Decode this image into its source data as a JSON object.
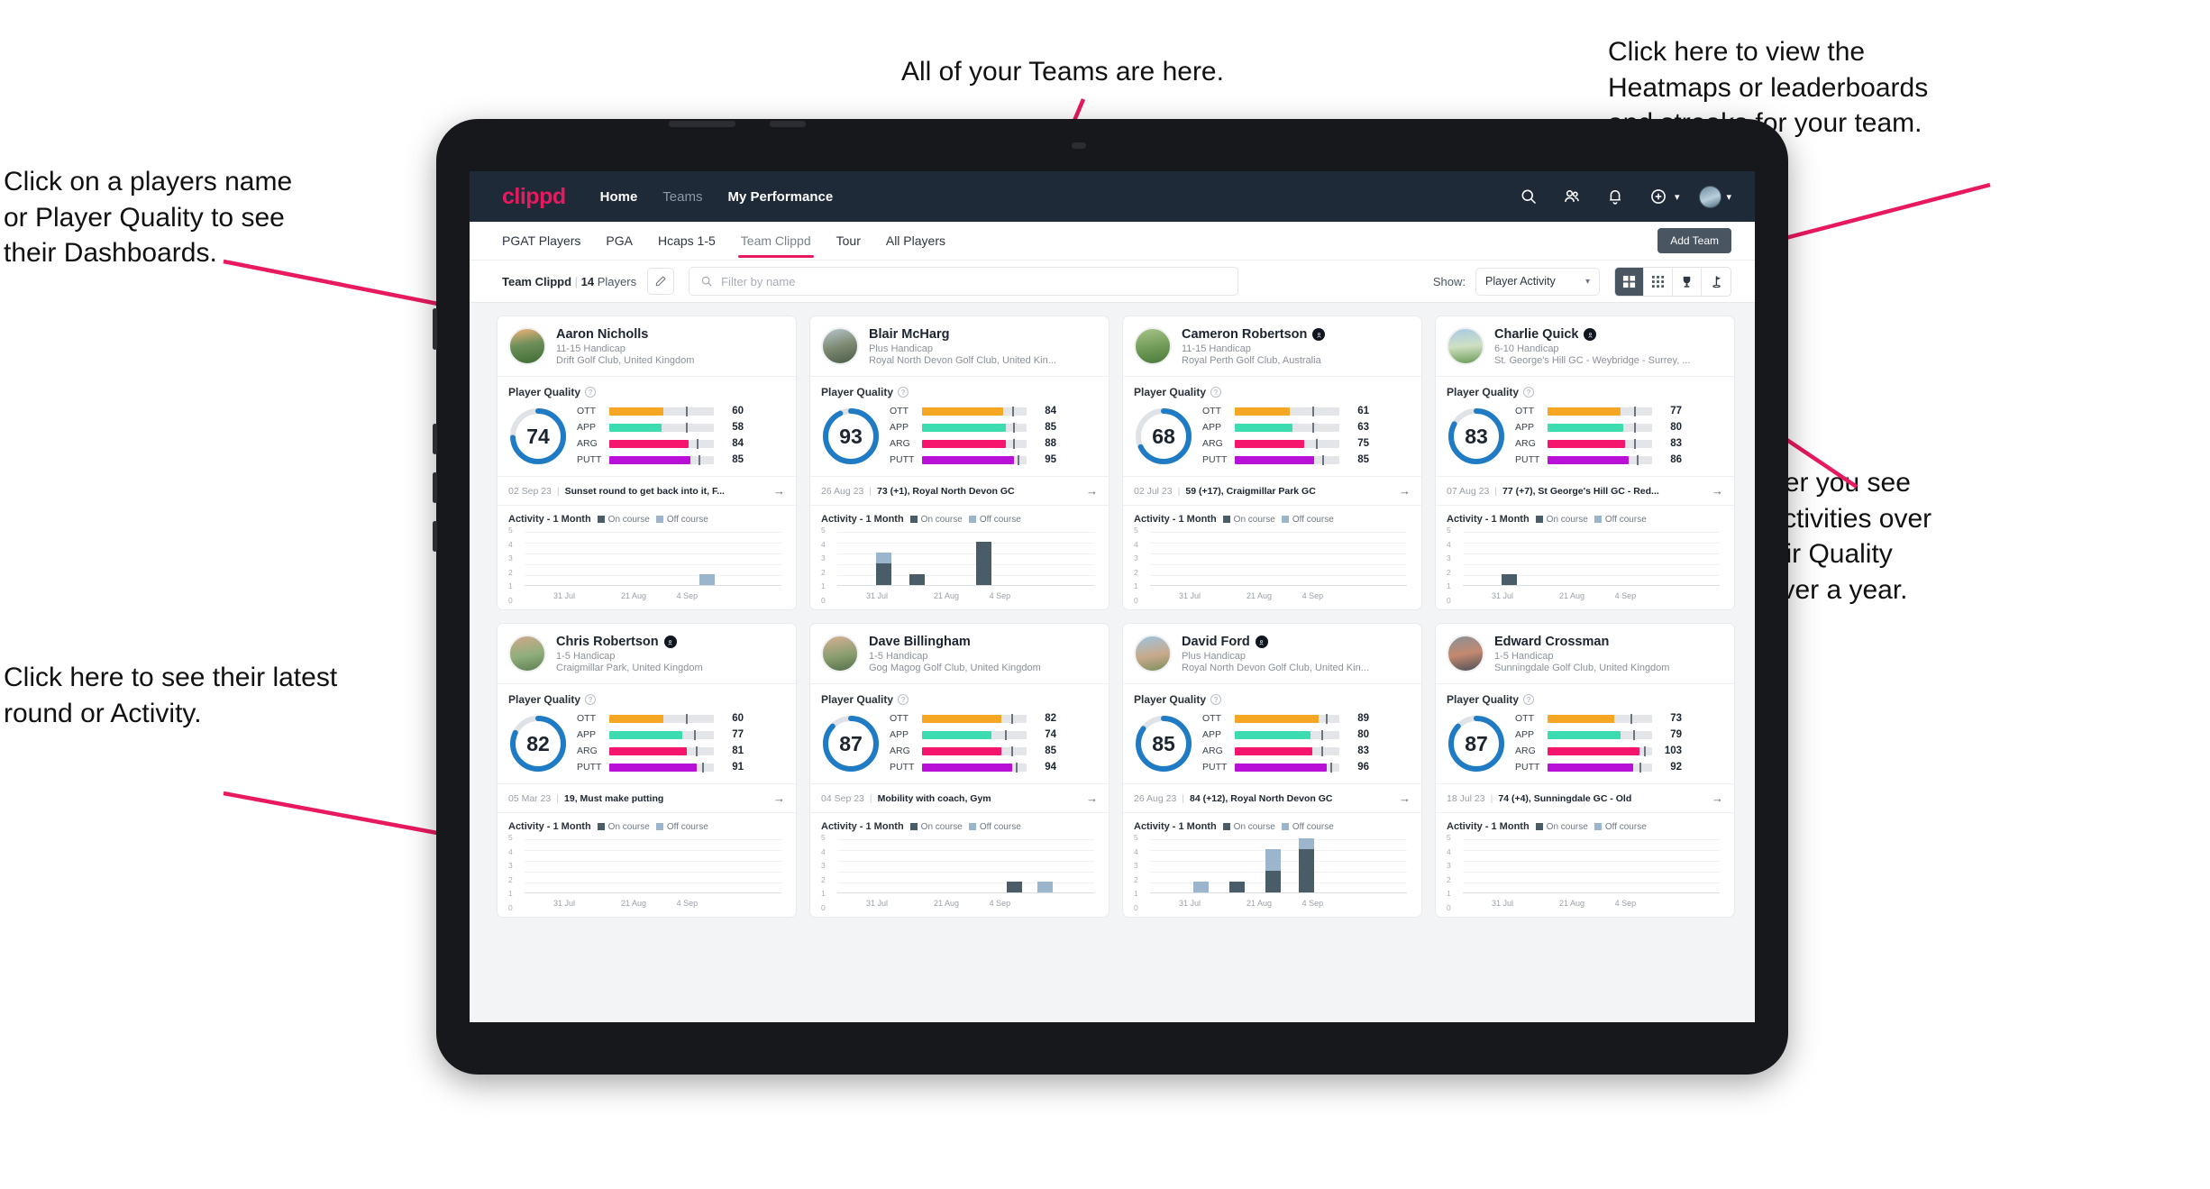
{
  "annotations": [
    {
      "id": "teams-note",
      "text": "All of your Teams are here."
    },
    {
      "id": "heatmaps-note",
      "text": "Click here to view the\nHeatmaps or leaderboards\nand streaks for your team."
    },
    {
      "id": "dashboards-note",
      "text": "Click on a players name\nor Player Quality to see\ntheir Dashboards."
    },
    {
      "id": "activity-toggle-note",
      "text": "Choose whether you see\nyour players Activities over\na month or their Quality\nScore Trend over a year."
    },
    {
      "id": "latest-round-note",
      "text": "Click here to see their latest\nround or Activity."
    }
  ],
  "header": {
    "brand": "clippd",
    "nav": [
      {
        "label": "Home",
        "active": true
      },
      {
        "label": "Teams",
        "active": false
      },
      {
        "label": "My Performance",
        "active": true
      }
    ],
    "icons": [
      "search-icon",
      "people-icon",
      "bell-icon",
      "plus-circle-icon",
      "avatar"
    ]
  },
  "subnav": {
    "tabs": [
      {
        "label": "PGAT Players",
        "active": false
      },
      {
        "label": "PGA",
        "active": false
      },
      {
        "label": "Hcaps 1-5",
        "active": false
      },
      {
        "label": "Team Clippd",
        "active": true
      },
      {
        "label": "Tour",
        "active": false
      },
      {
        "label": "All Players",
        "active": false
      }
    ],
    "add_team_label": "Add Team"
  },
  "filterbar": {
    "team_name": "Team Clippd",
    "team_count": "14",
    "team_count_suffix": "Players",
    "edit_icon": "pencil-icon",
    "search_placeholder": "Filter by name",
    "search_value": "",
    "show_label": "Show:",
    "show_value": "Player Activity",
    "view_buttons": [
      {
        "name": "grid-large-view",
        "icon": "grid-4-icon",
        "active": true
      },
      {
        "name": "grid-dense-view",
        "icon": "grid-9-icon",
        "active": false
      },
      {
        "name": "leaderboard-view",
        "icon": "trophy-icon",
        "active": false
      },
      {
        "name": "course-view",
        "icon": "flag-icon",
        "active": false
      }
    ]
  },
  "card_labels": {
    "player_quality": "Player Quality",
    "activity_title": "Activity - 1 Month",
    "legend_on": "On course",
    "legend_off": "Off course",
    "metrics": [
      "OTT",
      "APP",
      "ARG",
      "PUTT"
    ]
  },
  "colors": {
    "accent": "#e8195e",
    "ring": "#1e7bc4",
    "ott": "#f5a623",
    "app": "#3ddbb0",
    "arg": "#f5156c",
    "putt": "#b810d6",
    "on_course": "#4a5c68",
    "off_course": "#9bb6cc",
    "header_bg": "#1e2a38"
  },
  "chart_data": {
    "type": "bar",
    "title": "Activity - 1 Month",
    "ylim": [
      0,
      5
    ],
    "yticks": [
      0,
      1,
      2,
      3,
      4,
      5
    ],
    "xticks": [
      "31 Jul",
      "21 Aug",
      "4 Sep"
    ],
    "legend": [
      "On course",
      "Off course"
    ],
    "legend_position": "top",
    "grid": true,
    "charts": [
      {
        "player": "Aaron Nicholls",
        "bars": [
          {
            "pos": 0.68,
            "on": 0,
            "off": 1
          }
        ]
      },
      {
        "player": "Blair McHarg",
        "bars": [
          {
            "pos": 0.15,
            "on": 2,
            "off": 1
          },
          {
            "pos": 0.28,
            "on": 1,
            "off": 0
          },
          {
            "pos": 0.54,
            "on": 4,
            "off": 0
          }
        ]
      },
      {
        "player": "Cameron Robertson",
        "bars": []
      },
      {
        "player": "Charlie Quick",
        "bars": [
          {
            "pos": 0.15,
            "on": 1,
            "off": 0
          }
        ]
      },
      {
        "player": "Chris Robertson",
        "bars": []
      },
      {
        "player": "Dave Billingham",
        "bars": [
          {
            "pos": 0.66,
            "on": 1,
            "off": 0
          },
          {
            "pos": 0.78,
            "on": 0,
            "off": 1
          }
        ]
      },
      {
        "player": "David Ford",
        "bars": [
          {
            "pos": 0.17,
            "on": 0,
            "off": 1
          },
          {
            "pos": 0.31,
            "on": 1,
            "off": 0
          },
          {
            "pos": 0.45,
            "on": 2,
            "off": 2
          },
          {
            "pos": 0.58,
            "on": 4,
            "off": 1
          }
        ]
      },
      {
        "player": "Edward Crossman",
        "bars": []
      }
    ]
  },
  "players": [
    {
      "name": "Aaron Nicholls",
      "verified": false,
      "handicap": "11-15 Handicap",
      "club": "Drift Golf Club, United Kingdom",
      "quality": 74,
      "metrics": [
        {
          "label": "OTT",
          "value": 60,
          "fill": 52,
          "tick": 73
        },
        {
          "label": "APP",
          "value": 58,
          "fill": 50,
          "tick": 73
        },
        {
          "label": "ARG",
          "value": 84,
          "fill": 76,
          "tick": 84
        },
        {
          "label": "PUTT",
          "value": 85,
          "fill": 78,
          "tick": 85
        }
      ],
      "round_date": "02 Sep 23",
      "round_text": "Sunset round to get back into it, F..."
    },
    {
      "name": "Blair McHarg",
      "verified": false,
      "handicap": "Plus Handicap",
      "club": "Royal North Devon Golf Club, United Kin...",
      "quality": 93,
      "metrics": [
        {
          "label": "OTT",
          "value": 84,
          "fill": 78,
          "tick": 86
        },
        {
          "label": "APP",
          "value": 85,
          "fill": 80,
          "tick": 87
        },
        {
          "label": "ARG",
          "value": 88,
          "fill": 80,
          "tick": 87
        },
        {
          "label": "PUTT",
          "value": 95,
          "fill": 88,
          "tick": 91
        }
      ],
      "round_date": "26 Aug 23",
      "round_text": "73 (+1), Royal North Devon GC"
    },
    {
      "name": "Cameron Robertson",
      "verified": true,
      "handicap": "11-15 Handicap",
      "club": "Royal Perth Golf Club, Australia",
      "quality": 68,
      "metrics": [
        {
          "label": "OTT",
          "value": 61,
          "fill": 53,
          "tick": 74
        },
        {
          "label": "APP",
          "value": 63,
          "fill": 55,
          "tick": 74
        },
        {
          "label": "ARG",
          "value": 75,
          "fill": 66,
          "tick": 78
        },
        {
          "label": "PUTT",
          "value": 85,
          "fill": 76,
          "tick": 84
        }
      ],
      "round_date": "02 Jul 23",
      "round_text": "59 (+17), Craigmillar Park GC"
    },
    {
      "name": "Charlie Quick",
      "verified": true,
      "handicap": "6-10 Handicap",
      "club": "St. George's Hill GC - Weybridge - Surrey, ...",
      "quality": 83,
      "metrics": [
        {
          "label": "OTT",
          "value": 77,
          "fill": 70,
          "tick": 83
        },
        {
          "label": "APP",
          "value": 80,
          "fill": 72,
          "tick": 83
        },
        {
          "label": "ARG",
          "value": 83,
          "fill": 74,
          "tick": 83
        },
        {
          "label": "PUTT",
          "value": 86,
          "fill": 78,
          "tick": 85
        }
      ],
      "round_date": "07 Aug 23",
      "round_text": "77 (+7), St George's Hill GC - Red..."
    },
    {
      "name": "Chris Robertson",
      "verified": true,
      "handicap": "1-5 Handicap",
      "club": "Craigmillar Park, United Kingdom",
      "quality": 82,
      "metrics": [
        {
          "label": "OTT",
          "value": 60,
          "fill": 52,
          "tick": 73
        },
        {
          "label": "APP",
          "value": 77,
          "fill": 70,
          "tick": 81
        },
        {
          "label": "ARG",
          "value": 81,
          "fill": 74,
          "tick": 83
        },
        {
          "label": "PUTT",
          "value": 91,
          "fill": 84,
          "tick": 89
        }
      ],
      "round_date": "05 Mar 23",
      "round_text": "19, Must make putting"
    },
    {
      "name": "Dave Billingham",
      "verified": false,
      "handicap": "1-5 Handicap",
      "club": "Gog Magog Golf Club, United Kingdom",
      "quality": 87,
      "metrics": [
        {
          "label": "OTT",
          "value": 82,
          "fill": 76,
          "tick": 85
        },
        {
          "label": "APP",
          "value": 74,
          "fill": 66,
          "tick": 79
        },
        {
          "label": "ARG",
          "value": 85,
          "fill": 76,
          "tick": 85
        },
        {
          "label": "PUTT",
          "value": 94,
          "fill": 86,
          "tick": 90
        }
      ],
      "round_date": "04 Sep 23",
      "round_text": "Mobility with coach, Gym"
    },
    {
      "name": "David Ford",
      "verified": true,
      "handicap": "Plus Handicap",
      "club": "Royal North Devon Golf Club, United Kin...",
      "quality": 85,
      "metrics": [
        {
          "label": "OTT",
          "value": 89,
          "fill": 80,
          "tick": 87
        },
        {
          "label": "APP",
          "value": 80,
          "fill": 72,
          "tick": 83
        },
        {
          "label": "ARG",
          "value": 83,
          "fill": 74,
          "tick": 83
        },
        {
          "label": "PUTT",
          "value": 96,
          "fill": 88,
          "tick": 91
        }
      ],
      "round_date": "26 Aug 23",
      "round_text": "84 (+12), Royal North Devon GC"
    },
    {
      "name": "Edward Crossman",
      "verified": false,
      "handicap": "1-5 Handicap",
      "club": "Sunningdale Golf Club, United Kingdom",
      "quality": 87,
      "metrics": [
        {
          "label": "OTT",
          "value": 73,
          "fill": 64,
          "tick": 79
        },
        {
          "label": "APP",
          "value": 79,
          "fill": 70,
          "tick": 82
        },
        {
          "label": "ARG",
          "value": 103,
          "fill": 88,
          "tick": 92
        },
        {
          "label": "PUTT",
          "value": 92,
          "fill": 82,
          "tick": 88
        }
      ],
      "round_date": "18 Jul 23",
      "round_text": "74 (+4), Sunningdale GC - Old"
    }
  ]
}
